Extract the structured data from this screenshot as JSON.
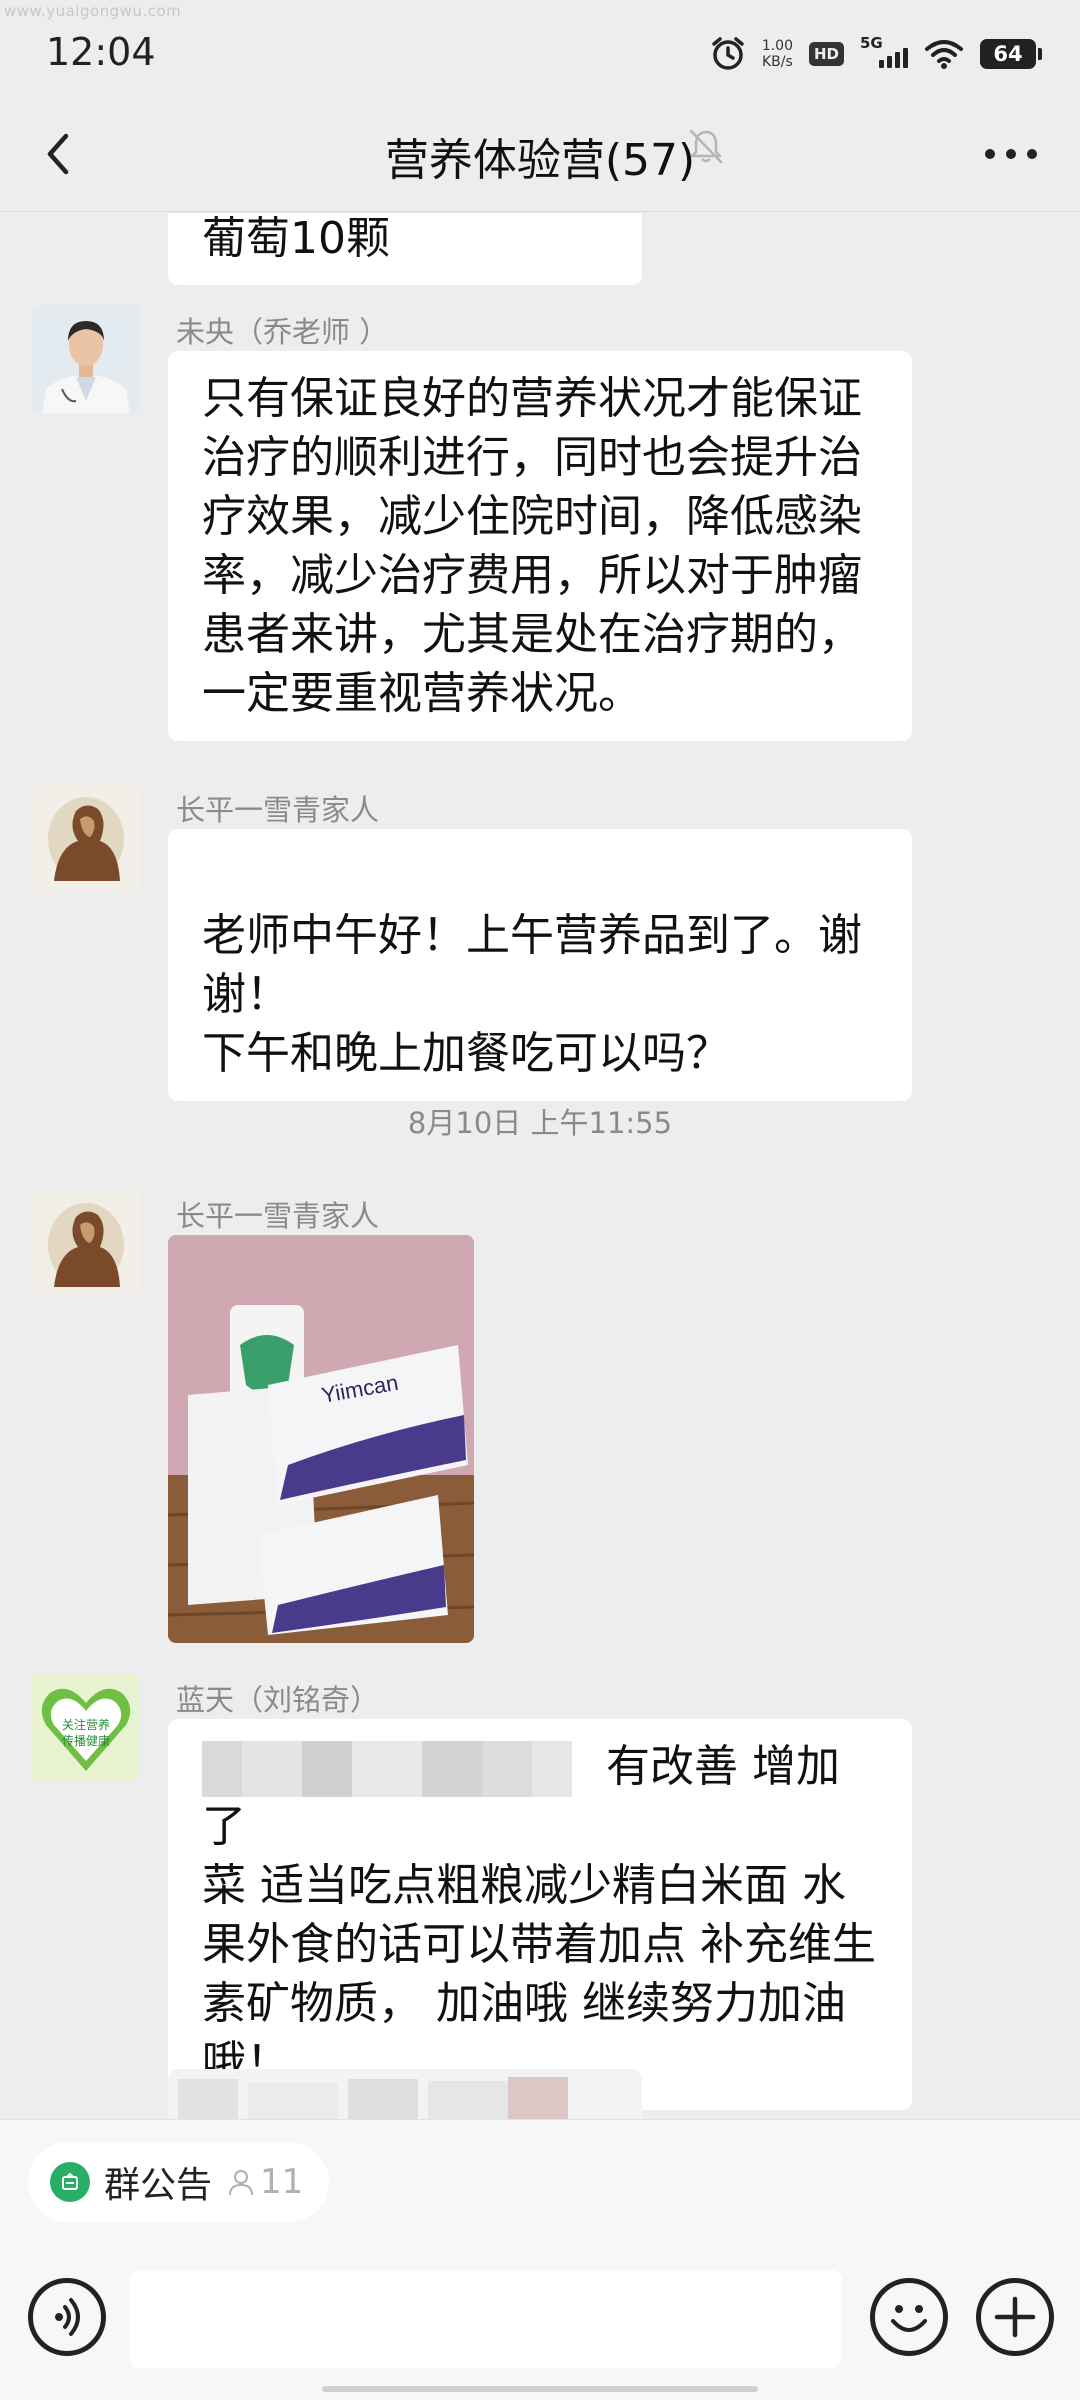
{
  "watermark": "www.yuaigongwu.com",
  "status_bar": {
    "time": "12:04",
    "net_speed_value": "1.00",
    "net_speed_unit": "KB/s",
    "hd": "HD",
    "network": "5G",
    "battery": "64"
  },
  "header": {
    "title": "营养体验营(57)"
  },
  "messages": {
    "partial_top": "葡萄10颗",
    "msg1": {
      "sender": "未央（乔老师 ）",
      "text": "只有保证良好的营养状况才能保证治疗的顺利进行，同时也会提升治疗效果，减少住院时间，降低感染率，减少治疗费用，所以对于肿瘤患者来讲，尤其是处在治疗期的，一定要重视营养状况。"
    },
    "msg2": {
      "sender": "长平一雪青家人",
      "text": "老师中午好！上午营养品到了。谢谢！\n下午和晚上加餐吃可以吗？"
    },
    "timestamp": "8月10日 上午11:55",
    "msg3": {
      "sender": "长平一雪青家人",
      "image_text": "Yiimcan"
    },
    "msg4": {
      "sender": "蓝天（刘铭奇）",
      "avatar_text_1": "关注营养",
      "avatar_text_2": "传播健康",
      "text_after_blur": "有改善 增加了",
      "text": "菜 适当吃点粗粮减少精白米面 水果外食的话可以带着加点 补充维生素矿物质， 加油哦 继续努力加油哦！"
    }
  },
  "footer": {
    "announcement_label": "群公告",
    "announcement_count": "11"
  },
  "colors": {
    "background": "#ededed",
    "bubble": "#ffffff",
    "accent_green": "#2aae67"
  }
}
